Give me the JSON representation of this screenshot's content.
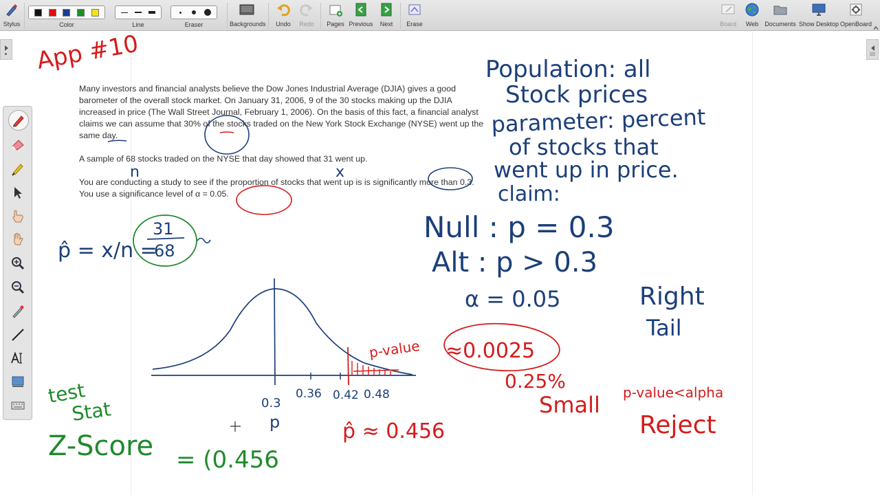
{
  "toolbar": {
    "stylus": "Stylus",
    "color": "Color",
    "line": "Line",
    "eraser": "Eraser",
    "backgrounds": "Backgrounds",
    "undo": "Undo",
    "redo": "Redo",
    "pages": "Pages",
    "previous": "Previous",
    "next": "Next",
    "erase": "Erase",
    "board": "Board",
    "web": "Web",
    "documents": "Documents",
    "show_desktop": "Show Desktop",
    "openboard": "OpenBoard",
    "colors": [
      "#111111",
      "#e01010",
      "#1a3d8f",
      "#1a8f2a",
      "#f2e21a"
    ]
  },
  "problem": {
    "p1": "Many investors and financial analysts believe the Dow Jones Industrial Average (DJIA) gives a good barometer of the overall stock market. On January 31, 2006, 9 of the 30 stocks making up the DJIA increased in price (The Wall Street Journal, February 1, 2006). On the basis of this fact, a financial analyst claims we can assume that 30% of the stocks traded on the New York Stock Exchange (NYSE) went up the same day.",
    "p2": "A sample of 68 stocks traded on the NYSE that day showed that 31 went up.",
    "p3": "You are conducting a study to see if the proportion of stocks that went up is is significantly more than 0.3. You use a significance level of α = 0.05."
  },
  "ink": {
    "app_label": "App #10",
    "n_mark": "n",
    "x_mark": "x",
    "phat_formula_left": "p̂ = x/n =",
    "frac_num": "31",
    "frac_den": "68",
    "population": "Population: all",
    "stock_prices": "Stock prices",
    "parameter": "parameter: percent",
    "of_stocks": "of stocks that",
    "went_up": "went up in price.",
    "claim": "claim:",
    "null": "Null : p = 0.3",
    "alt": "Alt : p > 0.3",
    "alpha": "α = 0.05",
    "right": "Right",
    "tail": "Tail",
    "pvalue": "p-value",
    "pvalue_approx": "≈0.0025",
    "pct": "0.25%",
    "small": "Small",
    "pv_lt_alpha": "p-value<alpha",
    "reject": "Reject",
    "tick_03": "0.3",
    "tick_036": "0.36",
    "tick_042": "0.42",
    "tick_048": "0.48",
    "p_label": "p",
    "phat_approx": "p̂ ≈ 0.456",
    "test": "test",
    "stat": "Stat",
    "zscore": "Z-Score",
    "z_value": "= (0.456",
    "ink_blue": "#1c3f7a",
    "ink_red": "#d41c1c",
    "ink_green": "#1f8a2c"
  }
}
